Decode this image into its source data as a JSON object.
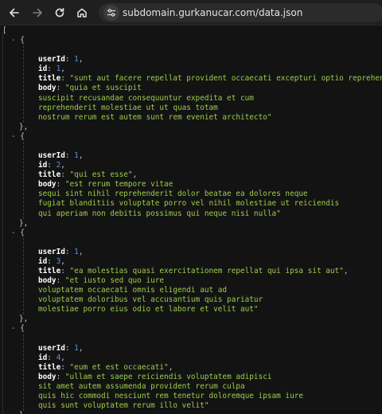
{
  "browser": {
    "url": "subdomain.gurkanucar.com/data.json"
  },
  "json_viewer": {
    "open_bracket": "[",
    "close_bracket": "]",
    "fold_marker": "-",
    "entries": [
      {
        "userId_key": "userId",
        "userId_value": "1",
        "id_key": "id",
        "id_value": "1",
        "title_key": "title",
        "title_value": "\"sunt aut facere repellat provident occaecati excepturi optio reprehend",
        "body_key": "body",
        "body_lines": [
          "\"quia et suscipit",
          "suscipit recusandae consequuntur expedita et cum",
          "reprehenderit molestiae ut ut quas totam",
          "nostrum rerum est autem sunt rem eveniet architecto\""
        ],
        "close": "},"
      },
      {
        "userId_key": "userId",
        "userId_value": "1",
        "id_key": "id",
        "id_value": "2",
        "title_key": "title",
        "title_value": "\"qui est esse\"",
        "body_key": "body",
        "body_lines": [
          "\"est rerum tempore vitae",
          "sequi sint nihil reprehenderit dolor beatae ea dolores neque",
          "fugiat blanditiis voluptate porro vel nihil molestiae ut reiciendis",
          "qui aperiam non debitis possimus qui neque nisi nulla\""
        ],
        "close": "},"
      },
      {
        "userId_key": "userId",
        "userId_value": "1",
        "id_key": "id",
        "id_value": "3",
        "title_key": "title",
        "title_value": "\"ea molestias quasi exercitationem repellat qui ipsa sit aut\"",
        "body_key": "body",
        "body_lines": [
          "\"et iusto sed quo iure",
          "voluptatem occaecati omnis eligendi aut ad",
          "voluptatem doloribus vel accusantium quis pariatur",
          "molestiae porro eius odio et labore et velit aut\""
        ],
        "close": "},"
      },
      {
        "userId_key": "userId",
        "userId_value": "1",
        "id_key": "id",
        "id_value": "4",
        "title_key": "title",
        "title_value": "\"eum et est occaecati\"",
        "body_key": "body",
        "body_lines": [
          "\"ullam et saepe reiciendis voluptatem adipisci",
          "sit amet autem assumenda provident rerum culpa",
          "quis hic commodi nesciunt rem tenetur doloremque ipsam iure",
          "quis sunt voluptatem rerum illo velit\""
        ],
        "close": "}"
      }
    ]
  }
}
